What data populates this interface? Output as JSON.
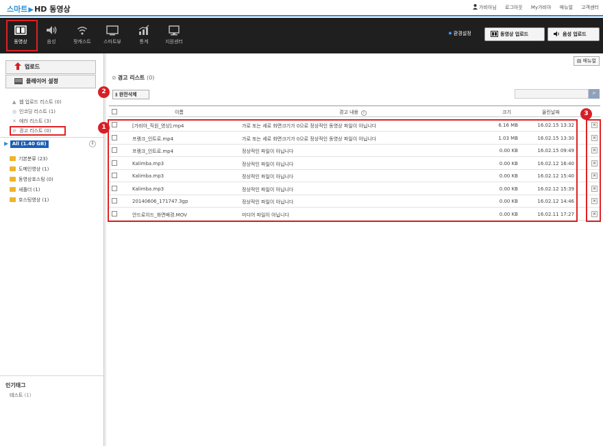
{
  "topbar": {
    "logo_smart": "스마트",
    "logo_rest": "HD 동영상",
    "links": {
      "user": "가비아님",
      "logout": "로그아웃",
      "mygabia": "My가비아",
      "manual": "매뉴얼",
      "support": "고객센터"
    }
  },
  "nav": {
    "items": [
      {
        "label": "동영상",
        "icon": "film-icon"
      },
      {
        "label": "음성",
        "icon": "speaker-icon"
      },
      {
        "label": "팟캐스트",
        "icon": "wifi-icon"
      },
      {
        "label": "스마트뷰",
        "icon": "monitor-icon"
      },
      {
        "label": "통계",
        "icon": "chart-icon"
      },
      {
        "label": "지원센터",
        "icon": "desktop-icon"
      }
    ],
    "env_label": "환경설정",
    "upload_video": "동영상 업로드",
    "upload_audio": "음성 업로드"
  },
  "sidebar": {
    "upload": "업로드",
    "player_settings": "플레이어 설정",
    "lists": [
      {
        "label": "웹 업로드 리스트",
        "count": "(0)",
        "icon": "up-arrow-icon"
      },
      {
        "label": "인코딩 리스트",
        "count": "(1)",
        "icon": "encode-icon"
      },
      {
        "label": "에러 리스트",
        "count": "(3)",
        "icon": "x-icon"
      },
      {
        "label": "경고 리스트",
        "count": "(0)",
        "icon": "warning-icon"
      }
    ],
    "all_label": "All (1.40 GB)",
    "folders": [
      {
        "label": "기본분류 (23)"
      },
      {
        "label": "도메인영상 (1)"
      },
      {
        "label": "동영상호스팅 (0)"
      },
      {
        "label": "새폴더 (1)"
      },
      {
        "label": "호스팅영상 (1)"
      }
    ],
    "tag_title": "인기태그",
    "tag_item": "테스트",
    "tag_count": "(1)"
  },
  "main": {
    "manual_btn": "매뉴얼",
    "title": "경고 리스트",
    "title_count": "(0)",
    "delete_btn": "완전삭제",
    "search_placeholder": "",
    "columns": {
      "name": "이름",
      "content": "경고 내용",
      "size": "크기",
      "date": "올린날짜"
    },
    "rows": [
      {
        "name": "[가비아_직원_영상].mp4",
        "content": "가로 또는 세로 화면크기가 0으로 정상적인 동영상 파일이 아닙니다",
        "size": "6.16 MB",
        "date": "16.02.15 13:32"
      },
      {
        "name": "프랭크_인트로.mp4",
        "content": "가로 또는 세로 화면크기가 0으로 정상적인 동영상 파일이 아닙니다",
        "size": "1.03 MB",
        "date": "16.02.15 13:30"
      },
      {
        "name": "프랭크_인트로.mp4",
        "content": "정상적인 파일이 아닙니다",
        "size": "0.00 KB",
        "date": "16.02.15 09:49"
      },
      {
        "name": "Kalimba.mp3",
        "content": "정상적인 파일이 아닙니다",
        "size": "0.00 KB",
        "date": "16.02.12 16:40"
      },
      {
        "name": "Kalimba.mp3",
        "content": "정상적인 파일이 아닙니다",
        "size": "0.00 KB",
        "date": "16.02.12 15:40"
      },
      {
        "name": "Kalimba.mp3",
        "content": "정상적인 파일이 아닙니다",
        "size": "0.00 KB",
        "date": "16.02.12 15:39"
      },
      {
        "name": "20140606_171747.3gp",
        "content": "정상적인 파일이 아닙니다",
        "size": "0.00 KB",
        "date": "16.02.12 14:46"
      },
      {
        "name": "안드로이드_화면배경.MOV",
        "content": "미디어 파일이 아닙니다",
        "size": "0.00 KB",
        "date": "16.02.11 17:27"
      }
    ]
  },
  "badges": {
    "one": "1",
    "two": "2",
    "three": "3"
  },
  "colors": {
    "accent": "#2f84c8",
    "highlight": "#e02020",
    "navbar": "#1f1f1f"
  }
}
